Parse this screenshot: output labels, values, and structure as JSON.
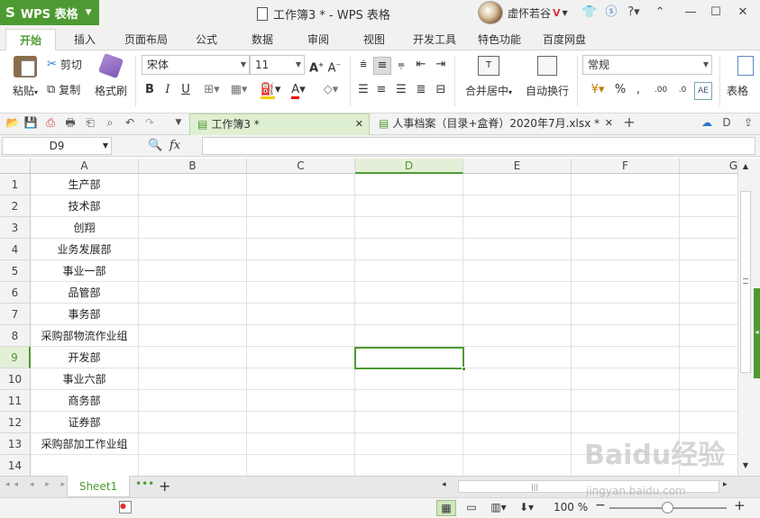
{
  "app": {
    "brand": "WPS 表格",
    "brand_logo": "S",
    "title": "工作簿3 * - WPS 表格",
    "user": "虚怀若谷",
    "vip": "V"
  },
  "menu": [
    "开始",
    "插入",
    "页面布局",
    "公式",
    "数据",
    "审阅",
    "视图",
    "开发工具",
    "特色功能",
    "百度网盘"
  ],
  "ribbon": {
    "paste": "粘贴",
    "cut": "剪切",
    "copy": "复制",
    "format_painter": "格式刷",
    "font": "宋体",
    "font_size": "11",
    "merge": "合并居中",
    "wrap": "自动换行",
    "number_format": "常规",
    "table": "表格"
  },
  "doc_tabs": [
    {
      "label": "工作簿3 *",
      "active": true
    },
    {
      "label": "人事档案（目录+盒脊）2020年7月.xlsx *",
      "active": false
    }
  ],
  "formula_bar": {
    "cell_ref": "D9",
    "fx": "fx",
    "value": ""
  },
  "columns": [
    "A",
    "B",
    "C",
    "D",
    "E",
    "F",
    "G"
  ],
  "selected_col": "D",
  "rows": [
    {
      "n": "1",
      "a": "生产部"
    },
    {
      "n": "2",
      "a": "技术部"
    },
    {
      "n": "3",
      "a": "创翔"
    },
    {
      "n": "4",
      "a": "业务发展部"
    },
    {
      "n": "5",
      "a": "事业一部"
    },
    {
      "n": "6",
      "a": "品管部"
    },
    {
      "n": "7",
      "a": "事务部"
    },
    {
      "n": "8",
      "a": "采购部物流作业组"
    },
    {
      "n": "9",
      "a": "开发部"
    },
    {
      "n": "10",
      "a": "事业六部"
    },
    {
      "n": "11",
      "a": "商务部"
    },
    {
      "n": "12",
      "a": "证券部"
    },
    {
      "n": "13",
      "a": "采购部加工作业组"
    },
    {
      "n": "14",
      "a": ""
    }
  ],
  "selected_row": "9",
  "sheet": {
    "name": "Sheet1",
    "more": "•••",
    "add": "+"
  },
  "status": {
    "zoom": "100 %",
    "minus": "−",
    "plus": "+"
  },
  "watermark": {
    "logo": "Baidu经验",
    "url": "jingyan.baidu.com"
  },
  "colors": {
    "accent": "#4e9a32"
  }
}
